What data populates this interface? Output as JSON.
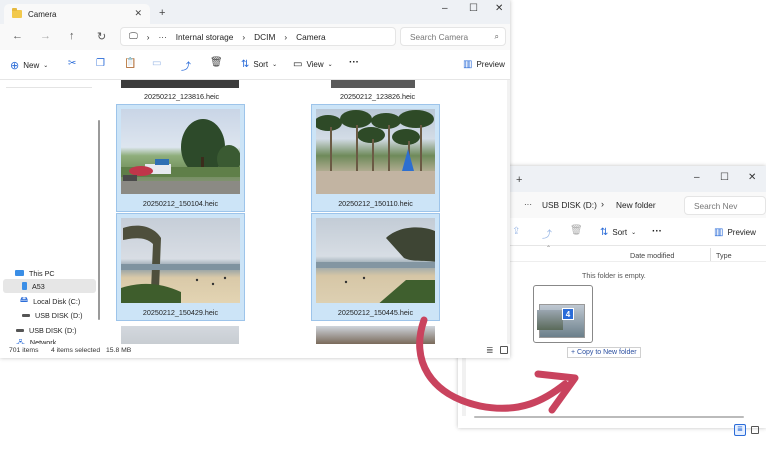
{
  "window1": {
    "tab_title": "Camera",
    "controls": {
      "min": "–",
      "max": "☐",
      "close": "✕"
    },
    "tab_add": "+",
    "nav": {
      "back": "←",
      "forward": "→",
      "up": "↑",
      "refresh": "↻"
    },
    "breadcrumb": [
      "Internal storage",
      "DCIM",
      "Camera"
    ],
    "breadcrumb_more": "···",
    "search_placeholder": "Search Camera",
    "toolbar": {
      "new": "New",
      "sort": "Sort",
      "view": "View",
      "more": "···",
      "preview": "Preview"
    },
    "sidebar": [
      {
        "label": "This PC",
        "icon": "pc-icon"
      },
      {
        "label": "A53",
        "icon": "phone-icon",
        "selected": true
      },
      {
        "label": "Local Disk (C:)",
        "icon": "disk-icon"
      },
      {
        "label": "USB DISK (D:)",
        "icon": "usb-icon"
      },
      {
        "label": "USB DISK (D:)",
        "icon": "usb-icon"
      },
      {
        "label": "Network",
        "icon": "network-icon"
      }
    ],
    "files_top": [
      "20250212_123816.heic",
      "20250212_123826.heic"
    ],
    "files": [
      {
        "name": "20250212_150104.heic",
        "selected": true,
        "scene": "park"
      },
      {
        "name": "20250212_150110.heic",
        "selected": true,
        "scene": "palms"
      },
      {
        "name": "20250212_150429.heic",
        "selected": true,
        "scene": "beach"
      },
      {
        "name": "20250212_150445.heic",
        "selected": true,
        "scene": "beach2"
      }
    ],
    "status": {
      "items": "701 items",
      "selected": "4 items selected",
      "size": "15.8 MB"
    }
  },
  "window2": {
    "controls": {
      "min": "–",
      "max": "☐",
      "close": "✕"
    },
    "tab_add": "+",
    "breadcrumb": [
      "USB DISK (D:)",
      "New folder"
    ],
    "breadcrumb_more": "···",
    "search_placeholder": "Search Nev",
    "toolbar": {
      "sort": "Sort",
      "more": "···",
      "preview": "Preview"
    },
    "columns": [
      "Date modified",
      "Type"
    ],
    "empty_text": "This folder is empty.",
    "drag_badge": "4",
    "drag_tooltip": "+ Copy to New folder"
  },
  "colors": {
    "accent": "#2b6cd8",
    "selection": "#cce4f7",
    "arrow": "#c9435e"
  }
}
